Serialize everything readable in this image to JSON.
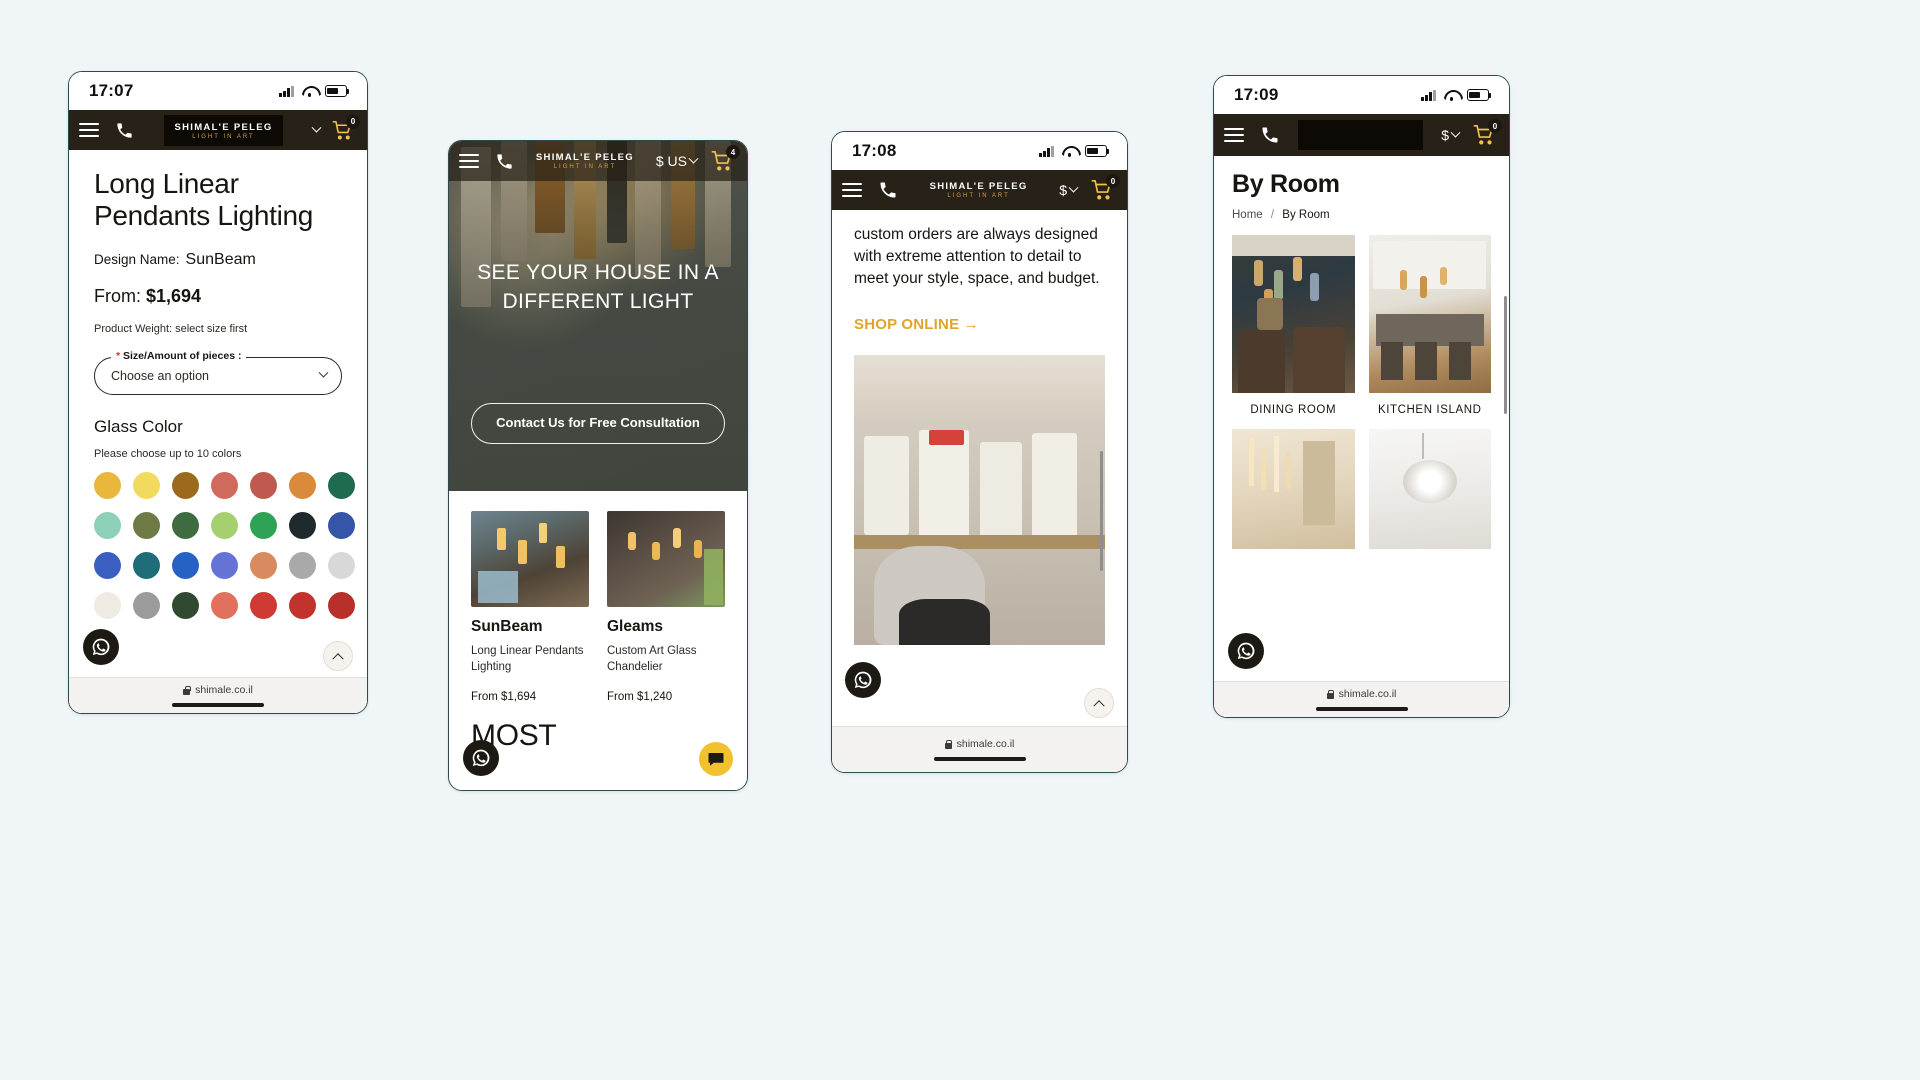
{
  "background_color": "#f0f6f7",
  "brand": {
    "name": "SHIMAL'E PELEG",
    "tagline": "LIGHT IN ART",
    "gold": "#d2a23c",
    "dark": "#272118"
  },
  "phone1": {
    "status": {
      "time": "17:07"
    },
    "nav": {
      "menu_icon": "hamburger-icon",
      "phone_icon": "phone-icon",
      "cart_icon": "cart-icon",
      "cart_count": "0"
    },
    "product": {
      "title": "Long Linear Pendants Lighting",
      "design_name_label": "Design Name:",
      "design_name_value": "SunBeam",
      "from_label": "From:",
      "price": "$1,694",
      "weight": "Product Weight: select size first",
      "size_label": "Size/Amount of pieces :",
      "size_required_mark": "*",
      "size_value": "Choose an option",
      "glass_color_heading": "Glass Color",
      "glass_color_hint": "Please choose up to 10 colors",
      "swatches": [
        "#e8b73c",
        "#f2da5e",
        "#9c6a1c",
        "#d06a5c",
        "#c05a50",
        "#d98a3a",
        "#1f6b4f",
        "#8dd0b8",
        "#6f7b46",
        "#3f6b41",
        "#a6cf70",
        "#2fa355",
        "#1e2a2c",
        "#3455a8",
        "#3b5fc0",
        "#1f6d78",
        "#2661c4",
        "#6673d6",
        "#d78b5e",
        "#a9a9a9",
        "#d8d8d8",
        "#efeae2",
        "#9b9b9b",
        "#2f4a30",
        "#e1705c",
        "#d03a34",
        "#c1332c",
        "#b8302a"
      ]
    },
    "fab": {
      "whatsapp": "whatsapp-icon",
      "scroll_top": "chevron-up-icon"
    },
    "urlbar": {
      "url": "shimale.co.il",
      "lock": "lock-icon"
    }
  },
  "phone2": {
    "nav": {
      "menu_icon": "hamburger-icon",
      "phone_icon": "phone-icon",
      "currency": "$ US",
      "cart_icon": "cart-icon",
      "cart_count": "4"
    },
    "hero": {
      "heading": "SEE YOUR HOUSE IN A DIFFERENT LIGHT",
      "cta": "Contact Us for Free Consultation"
    },
    "products": [
      {
        "title": "SunBeam",
        "desc": "Long Linear Pendants Lighting",
        "price": "From $1,694",
        "image": "pendant-lights-hall-photo"
      },
      {
        "title": "Gleams",
        "desc": "Custom Art Glass Chandelier",
        "price": "From $1,240",
        "image": "glass-chandelier-room-photo"
      }
    ],
    "section_heading": "MOST",
    "fab": {
      "whatsapp": "whatsapp-icon",
      "chat": "chat-bubble-icon"
    }
  },
  "phone3": {
    "status": {
      "time": "17:08"
    },
    "nav": {
      "menu_icon": "hamburger-icon",
      "phone_icon": "phone-icon",
      "currency": "$",
      "cart_icon": "cart-icon",
      "cart_count": "0"
    },
    "paragraph": "custom orders are always designed with extreme attention to detail to meet your style, space, and budget.",
    "shop_link": "SHOP ONLINE →",
    "photo": "artisan-in-studio-photo",
    "fab": {
      "whatsapp": "whatsapp-icon",
      "scroll_top": "chevron-up-icon"
    },
    "urlbar": {
      "url": "shimale.co.il",
      "lock": "lock-icon"
    }
  },
  "phone4": {
    "status": {
      "time": "17:09"
    },
    "nav": {
      "menu_icon": "hamburger-icon",
      "phone_icon": "phone-icon",
      "currency": "$",
      "cart_icon": "cart-icon",
      "cart_count": "0"
    },
    "page_title": "By Room",
    "breadcrumb": {
      "home": "Home",
      "separator": "/",
      "current": "By Room"
    },
    "rooms": [
      {
        "label": "DINING ROOM",
        "image": "dining-room-pendants-photo"
      },
      {
        "label": "KITCHEN ISLAND",
        "image": "kitchen-island-pendants-photo"
      },
      {
        "label": "",
        "image": "hallway-lights-photo"
      },
      {
        "label": "",
        "image": "ceiling-chandelier-photo"
      }
    ],
    "fab": {
      "whatsapp": "whatsapp-icon"
    },
    "urlbar": {
      "url": "shimale.co.il",
      "lock": "lock-icon"
    }
  }
}
